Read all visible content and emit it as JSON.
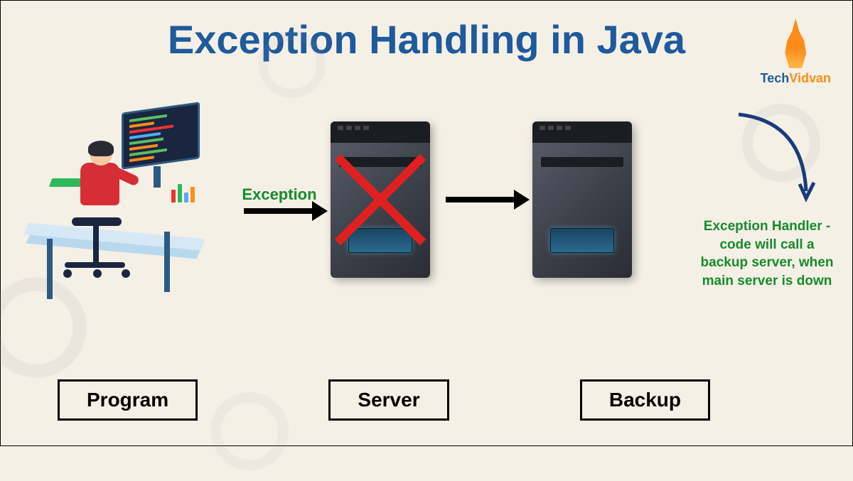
{
  "title": "Exception Handling in Java",
  "logo": {
    "brand1": "Tech",
    "brand2": "Vidvan"
  },
  "diagram": {
    "nodes": {
      "program": "Program",
      "server": "Server",
      "backup": "Backup"
    },
    "arrows": {
      "exception": "Exception"
    },
    "handler_text": "Exception Handler - code will call a backup server, when main server is down"
  }
}
